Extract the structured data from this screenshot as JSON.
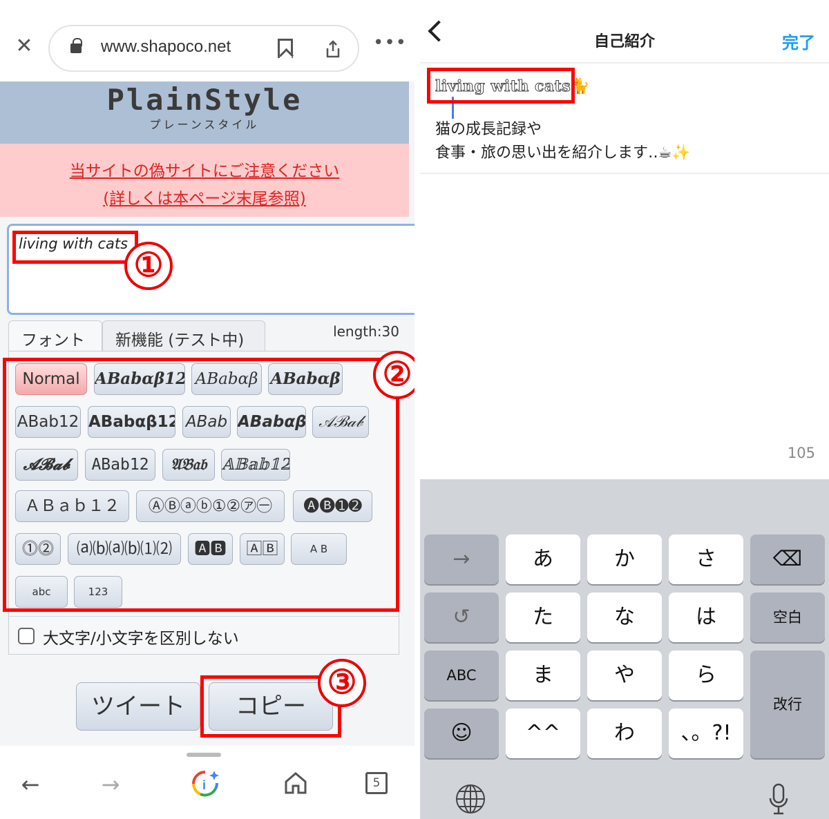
{
  "browser": {
    "url": "www.shapoco.net",
    "tab_count": "5",
    "icons": {
      "close": "close-icon",
      "lock": "lock-icon",
      "bookmark": "bookmark-icon",
      "share": "share-icon",
      "more": "more-icon",
      "back": "arrow-left-icon",
      "forward": "arrow-right-icon",
      "assistant": "google-lens-icon",
      "home": "home-icon",
      "tabs": "tabs-icon"
    }
  },
  "site": {
    "logo": "PlainStyle",
    "logo_sub": "プレーンスタイル",
    "warning_line1": "当サイトの偽サイトにご注意ください",
    "warning_line2": "(詳しくは本ページ末尾参照)",
    "input_text": "living with cats",
    "tabs": [
      {
        "label": "フォント",
        "active": true
      },
      {
        "label": "新機能 (テスト中)",
        "active": false
      }
    ],
    "length_label": "length:30",
    "font_buttons": [
      {
        "label": "Normal",
        "selected": true
      },
      {
        "label": "ABabαβ12"
      },
      {
        "label": "ABabαβ"
      },
      {
        "label": "ABabαβ"
      },
      {
        "label": "ABab12"
      },
      {
        "label": "ABabαβ12"
      },
      {
        "label": "ABab"
      },
      {
        "label": "ABabαβ"
      },
      {
        "label": "𝒜ℬ𝒶𝒷"
      },
      {
        "label": "𝓐𝓑𝓪𝓫"
      },
      {
        "label": "ABab12"
      },
      {
        "label": "𝔄𝔅𝔞𝔟"
      },
      {
        "label": "𝔸𝔹𝕒𝕓𝟙𝟚"
      },
      {
        "label": "ＡＢａｂ１２"
      },
      {
        "label": "ⒶⒷⓐⓑ①②㋐㊀"
      },
      {
        "label": "🅐🅑➊➋"
      },
      {
        "label": "⓵⓶"
      },
      {
        "label": "⒜⒝⒜⒝⑴⑵"
      },
      {
        "label": "🅰🅱"
      },
      {
        "label": "🄰🄱"
      },
      {
        "label": "A B"
      },
      {
        "label": "abc"
      },
      {
        "label": "123"
      }
    ],
    "checkbox_label": "大文字/小文字を区別しない",
    "tweet_button": "ツイート",
    "copy_button": "コピー"
  },
  "annotations": [
    "①",
    "②",
    "③"
  ],
  "instagram": {
    "title": "自己紹介",
    "done": "完了",
    "bio_line1": "living with cats",
    "bio_line1_emoji": "🐈",
    "bio_line2": "猫の成長記録や",
    "bio_line3": "食事・旅の思い出を紹介します‥☕✨",
    "char_count": "105"
  },
  "keyboard": {
    "rows": [
      [
        "→",
        "あ",
        "か",
        "さ",
        "⌫"
      ],
      [
        "↺",
        "た",
        "な",
        "は",
        "空白"
      ],
      [
        "ABC",
        "ま",
        "や",
        "ら",
        "改行"
      ],
      [
        "☺",
        "^^",
        "わ",
        "、。?!"
      ]
    ],
    "globe": "globe-icon",
    "mic": "microphone-icon"
  }
}
